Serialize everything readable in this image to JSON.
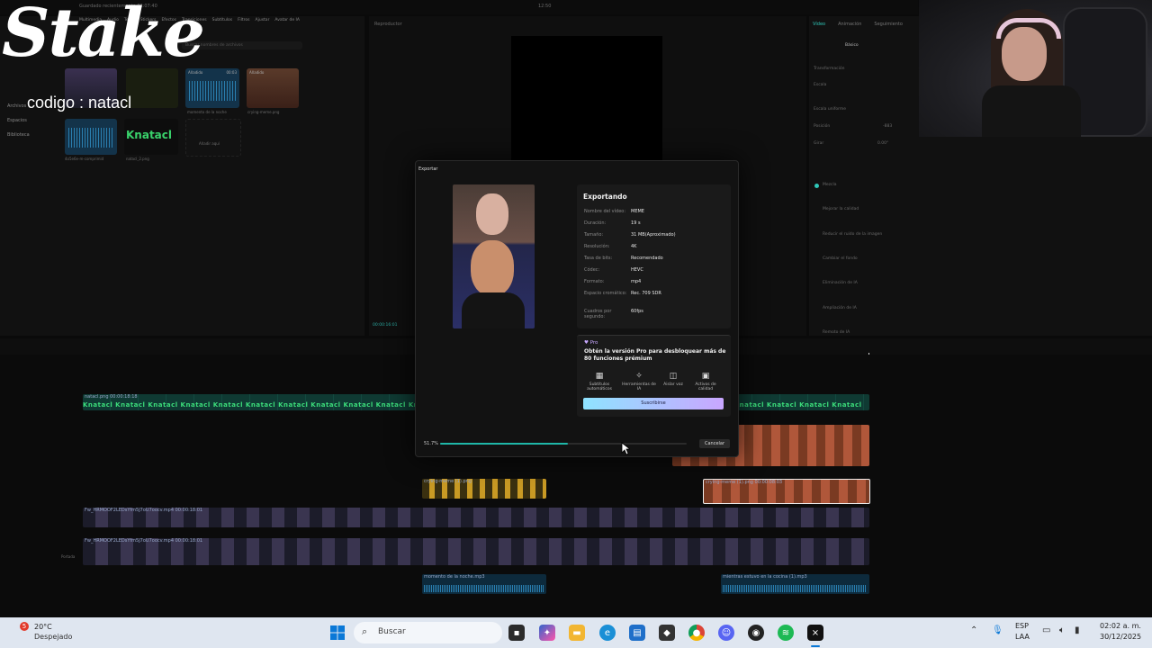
{
  "window": {
    "title": "Guardado recientemente 02:07:40",
    "clock_top": "12:50"
  },
  "overlay": {
    "brand": "Stake",
    "code_text": "codigo : natacl"
  },
  "top_tabs": [
    "Multimedia",
    "Audio",
    "Texto",
    "Stickers",
    "Efectos",
    "Transiciones",
    "Subtítulos",
    "Filtros",
    "Ajustar",
    "Avatar de IA"
  ],
  "media_sidebar": [
    "Archivos",
    "Espacios",
    "Biblioteca"
  ],
  "media_search_placeholder": "Buscar nombres de archivos",
  "media_items": [
    {
      "tag": "Añadido",
      "name": "mientras"
    },
    {
      "tag": "Añadido",
      "name": "",
      "duration": "00:03"
    },
    {
      "tag": "Añadido",
      "name": "momento de la noche"
    },
    {
      "tag": "Añadido",
      "name": "crying-meme.png"
    },
    {
      "tag": "Añadido",
      "name": "4o5e6e-m-comprimid"
    },
    {
      "tag": "Añadido",
      "name": "natacl_2.png"
    },
    {
      "tag": "",
      "name": "Añadir aquí"
    }
  ],
  "media_logo_text": "Knatacl",
  "player": {
    "title": "Reproductor",
    "time": "00:00:16:01"
  },
  "right_panel": {
    "tabs": [
      "Vídeo",
      "Animación",
      "Seguimiento"
    ],
    "subtab": "Básico",
    "section": "Transformación",
    "escala": "Escala",
    "escala_uniforme": "Escala uniforme",
    "posicion": "Posición",
    "posicion_x": "-883",
    "girar": "Girar",
    "girar_val": "0.00°",
    "mezcla": "Mezcla",
    "options": [
      "Mejorar la calidad",
      "Reducir el ruido de la imagen",
      "Cambiar el fondo",
      "Eliminación de IA",
      "Ampliación de IA",
      "Remoto de IA"
    ]
  },
  "export": {
    "dialog_title": "Exportar",
    "status": "Exportando",
    "rows": [
      {
        "k": "Nombre del vídeo:",
        "v": "MEME"
      },
      {
        "k": "Duración:",
        "v": "19 s"
      },
      {
        "k": "Tamaño:",
        "v": "31 MB(Aproximado)"
      },
      {
        "k": "Resolución:",
        "v": "4K"
      },
      {
        "k": "Tasa de bits:",
        "v": "Recomendado"
      },
      {
        "k": "Códec:",
        "v": "HEVC"
      },
      {
        "k": "Formato:",
        "v": "mp4"
      },
      {
        "k": "Espacio cromático:",
        "v": "Rec. 709 SDR"
      },
      {
        "k": "Cuadros por segundo:",
        "v": "60fps"
      }
    ],
    "pro_badge": "Pro",
    "pro_text": "Obtén la versión Pro para desbloquear más de 80 funciones prémium",
    "features": [
      "Subtítulos automáticos",
      "Herramientas de IA",
      "Aislar voz",
      "Activos de calidad"
    ],
    "subscribe": "Suscribirse",
    "progress_label": "51.7%",
    "progress": 0.517,
    "cancel": "Cancelar"
  },
  "timeline": {
    "captions": [
      "natacl.png  00:00:18:18",
      "crying-meme (1).png",
      "crying-meme (1).png  00:00:08:03",
      "Fw_HRMOOF2LEDsYfm5J7oU7oocv.mp4  00:00:18:01",
      "Fw_HRMOOF2LEDsYfm5J7oU7oocv.mp4  00:00:18:01",
      "Extraído - momento de la noche",
      "momento de la noche.mp3",
      "mientras estuvo en la cocina (1).mp3"
    ],
    "logo_clip_text": "Knatacl",
    "cover_label": "Portada"
  },
  "taskbar": {
    "weather_temp": "20°C",
    "weather_desc": "Despejado",
    "search": "Buscar",
    "lang": "ESP",
    "lang2": "LAA",
    "time": "02:02 a. m.",
    "date": "30/12/2025",
    "badge": "5"
  },
  "colors": {
    "accent": "#17c3b2",
    "progress": "#1fb7a8",
    "subscribe_start": "#8fe3ff",
    "subscribe_end": "#c9a6ff",
    "taskbar": "#dfe6f0"
  }
}
